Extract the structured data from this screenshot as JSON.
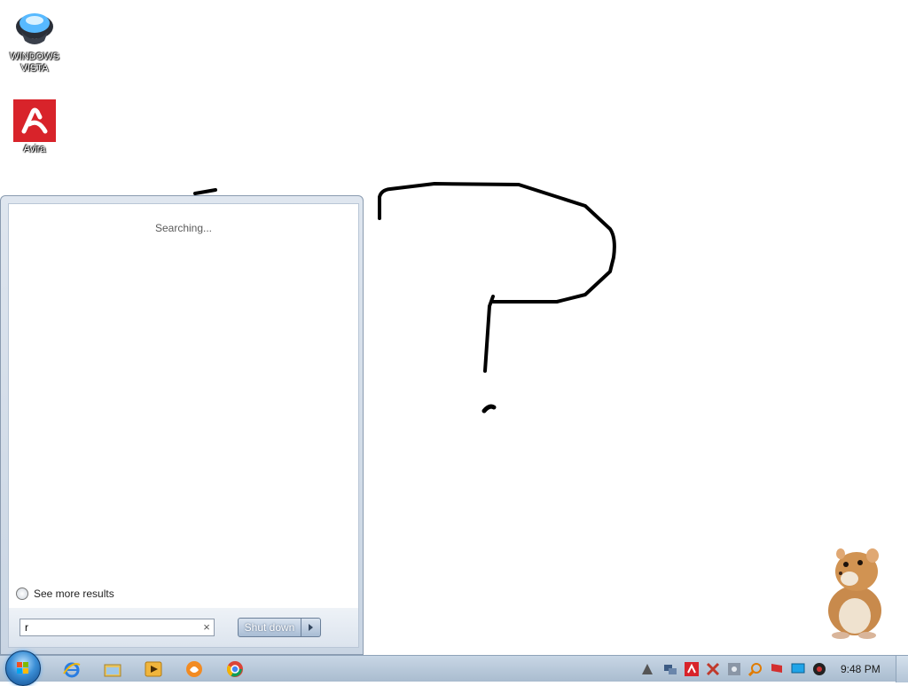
{
  "desktop": {
    "icons": [
      {
        "label": "WINDOWS\nVISTA",
        "name": "windows-vista"
      },
      {
        "label": "Avira",
        "name": "avira"
      }
    ]
  },
  "start_menu": {
    "status_text": "Searching...",
    "see_more_label": "See more results",
    "search_value": "r",
    "clear_icon": "×",
    "shutdown_label": "Shut down"
  },
  "taskbar": {
    "pinned": [
      "internet-explorer-icon",
      "windows-explorer-icon",
      "media-player-icon",
      "app-icon",
      "chrome-icon"
    ],
    "tray": [
      "avast-icon",
      "network-icon",
      "avira-tray-icon",
      "flag-icon",
      "settings-icon",
      "search-icon",
      "red-flag-icon",
      "monitor-icon",
      "volume-icon"
    ],
    "clock": "9:48 PM"
  },
  "colors": {
    "taskbar": "#b7c8da",
    "avira_red": "#d8232a",
    "start_orb": "#3b8fd6"
  }
}
